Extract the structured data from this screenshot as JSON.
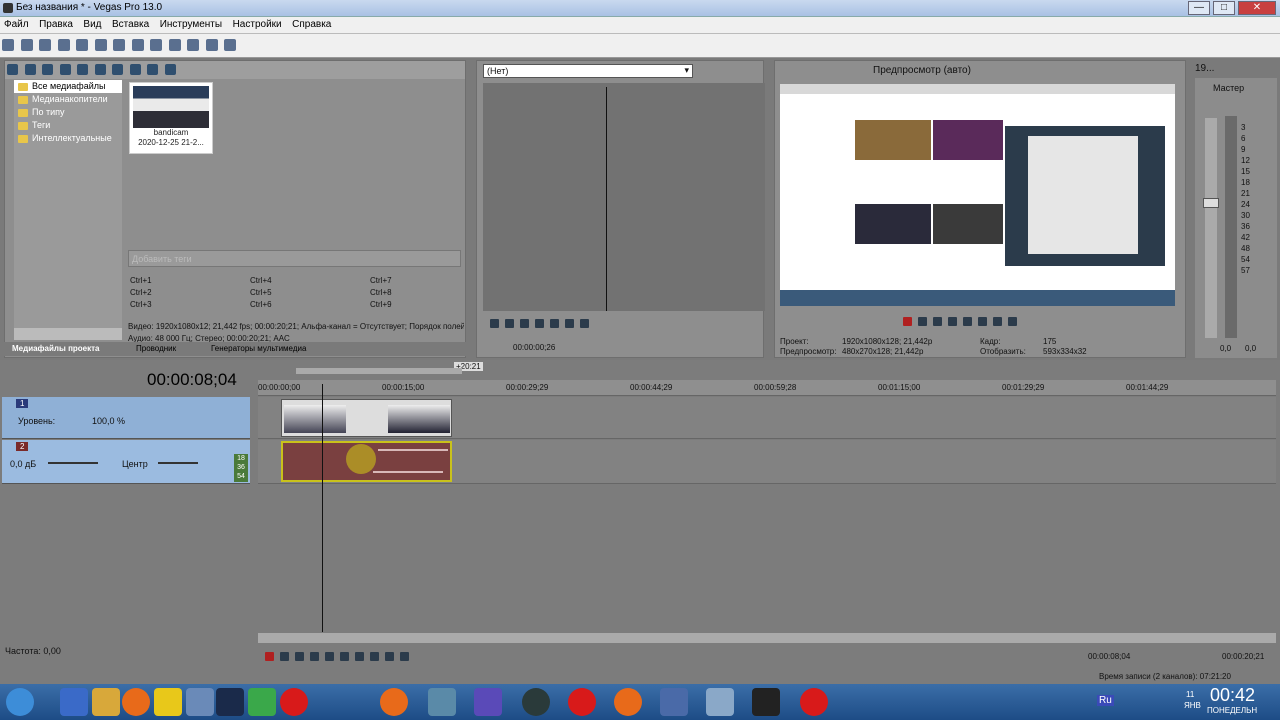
{
  "window": {
    "title": "Без названия * - Vegas Pro 13.0",
    "min": "—",
    "max": "□",
    "close": "✕"
  },
  "menu": [
    "Файл",
    "Правка",
    "Вид",
    "Вставка",
    "Инструменты",
    "Настройки",
    "Справка"
  ],
  "explorer": {
    "tree": [
      "Все медиафайлы",
      "Медианакопители",
      "По типу",
      "Теги",
      "Интеллектуальные"
    ],
    "media": {
      "name": "bandicam",
      "date": "2020-12-25 21-2..."
    },
    "tags_placeholder": "Добавить теги",
    "shortcuts": [
      "Ctrl+1",
      "Ctrl+4",
      "Ctrl+7",
      "Ctrl+2",
      "Ctrl+5",
      "Ctrl+8",
      "Ctrl+3",
      "Ctrl+6",
      "Ctrl+9"
    ],
    "info_video": "Видео: 1920x1080x12; 21,442 fps; 00:00:20;21; Альфа-канал = Отсутствует; Порядок полей",
    "info_audio": "Аудио: 48 000 Гц; Стерео; 00:00:20;21; AAC",
    "tabs": [
      "Медиафайлы проекта",
      "Проводник",
      "Генераторы мультимедиа"
    ]
  },
  "trimmer": {
    "dropdown": "(Нет)",
    "time": "00:00:00;26"
  },
  "preview": {
    "mode": "Предпросмотр (авто)",
    "project_label": "Проект:",
    "project_value": "1920x1080x128; 21,442p",
    "preview_label": "Предпросмотр:",
    "preview_value": "480x270x128; 21,442p",
    "frame_label": "Кадр:",
    "frame_value": "175",
    "display_label": "Отобразить:",
    "display_value": "593x334x32"
  },
  "mixer": {
    "tab": "19...",
    "master": "Мастер",
    "scale": [
      "3",
      "6",
      "9",
      "12",
      "15",
      "18",
      "21",
      "24",
      "30",
      "36",
      "42",
      "48",
      "54",
      "57"
    ],
    "level_left": "0,0",
    "level_right": "0,0"
  },
  "timeline": {
    "current_time": "00:00:08;04",
    "loop_length": "+20:21",
    "ticks": [
      "00:00:00;00",
      "00:00:15;00",
      "00:00:29;29",
      "00:00:44;29",
      "00:00:59;28",
      "00:01:15;00",
      "00:01:29;29",
      "00:01:44;29"
    ],
    "video_track": {
      "number": "1",
      "level_label": "Уровень:",
      "level_value": "100,0 %"
    },
    "audio_track": {
      "number": "2",
      "volume": "0,0 дБ",
      "pan": "Центр",
      "meter": [
        "18",
        "36",
        "54"
      ]
    },
    "rate_label": "Частота: 0,00",
    "status_time": "00:00:08;04",
    "status_end": "00:00:20;21",
    "record_time": "Время записи (2 каналов): 07:21:20"
  },
  "taskbar": {
    "lang": "Ru",
    "time": "00:42",
    "day": "ПОНЕДЕЛЬН",
    "date_day": "11",
    "date_month": "ЯНВ"
  },
  "colors": {
    "accent": "#8fb0d6",
    "audio_clip": "#7a4040",
    "clip_border": "#c9c21b",
    "taskbar": "#1d4c86"
  }
}
